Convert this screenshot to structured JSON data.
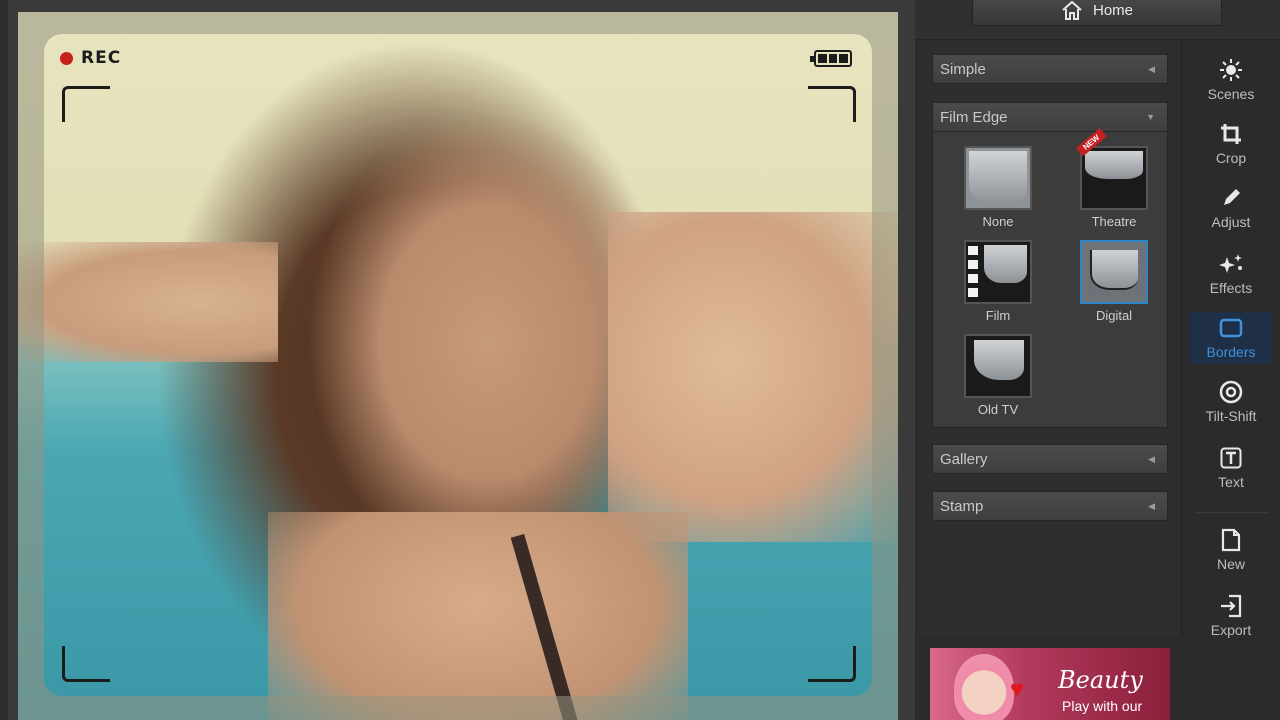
{
  "home": {
    "label": "Home",
    "icon": "home-icon"
  },
  "viewfinder": {
    "rec_label": "REC",
    "battery_icon": "battery-icon"
  },
  "sections": {
    "simple": {
      "label": "Simple"
    },
    "film_edge": {
      "label": "Film Edge",
      "items": [
        {
          "label": "None"
        },
        {
          "label": "Theatre",
          "badge": "NEW"
        },
        {
          "label": "Film"
        },
        {
          "label": "Digital",
          "selected": true
        },
        {
          "label": "Old TV"
        }
      ]
    },
    "gallery": {
      "label": "Gallery"
    },
    "stamp": {
      "label": "Stamp"
    }
  },
  "tools": [
    {
      "label": "Scenes",
      "icon": "sun-icon"
    },
    {
      "label": "Crop",
      "icon": "crop-icon"
    },
    {
      "label": "Adjust",
      "icon": "pencil-icon"
    },
    {
      "label": "Effects",
      "icon": "sparkle-icon"
    },
    {
      "label": "Borders",
      "icon": "border-icon",
      "active": true
    },
    {
      "label": "Tilt-Shift",
      "icon": "tilt-shift-icon"
    },
    {
      "label": "Text",
      "icon": "text-icon"
    },
    {
      "label": "New",
      "icon": "new-file-icon"
    },
    {
      "label": "Export",
      "icon": "export-icon"
    }
  ],
  "ad": {
    "title": "Beauty",
    "subtitle": "Play with our"
  },
  "colors": {
    "accent": "#3c93e0",
    "selected_border": "#2d86c8",
    "rec_dot": "#c8201a"
  }
}
